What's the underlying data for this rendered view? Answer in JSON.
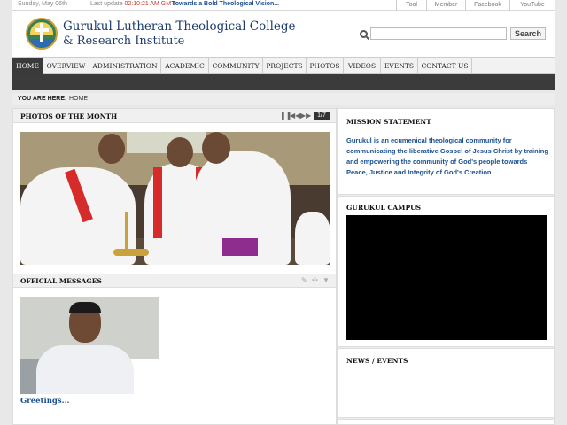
{
  "topbar": {
    "date": "Sunday, May 06th",
    "last_update_label": "Last update",
    "last_update_time": "02:10:21 AM GMT",
    "ticker": "Towards a Bold Theological Vision...",
    "links": [
      "Tool",
      "Member",
      "Facebook",
      "YouTube"
    ]
  },
  "header": {
    "title_line1": "Gurukul Lutheran Theological College",
    "title_line2": "& Research Institute",
    "search_placeholder": "",
    "search_button": "Search"
  },
  "nav": {
    "items": [
      "HOME",
      "OVERVIEW",
      "ADMINISTRATION",
      "ACADEMIC",
      "COMMUNITY",
      "PROJECTS",
      "PHOTOS",
      "VIDEOS",
      "EVENTS",
      "CONTACT US"
    ],
    "active_index": 0
  },
  "breadcrumb": {
    "label": "YOU ARE HERE:",
    "current": "HOME"
  },
  "photos": {
    "heading": "PHOTOS OF THE MONTH",
    "counter": "1/7"
  },
  "messages": {
    "heading": "OFFICIAL MESSAGES",
    "link": "Greetings..."
  },
  "sidebar": {
    "mission_heading": "MISSION STATEMENT",
    "mission_text": "Gurukul is an ecumenical theological community for communicating the liberative Gospel of Jesus Christ by training and empowering the community of God's people towards Peace, Justice and Integrity of God's Creation",
    "campus_heading": "GURUKUL CAMPUS",
    "news_heading": "NEWS / EVENTS"
  },
  "colors": {
    "link_blue": "#1a4f8f",
    "update_red": "#c0392b",
    "nav_active": "#3a3a3a"
  }
}
